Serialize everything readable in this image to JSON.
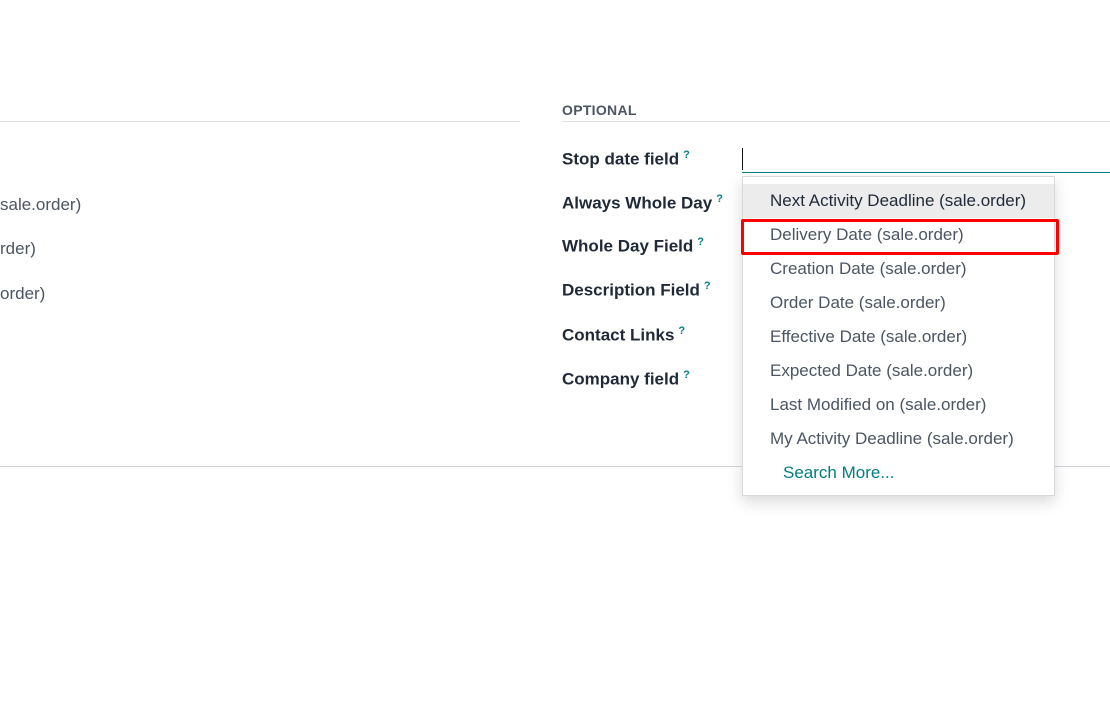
{
  "left_panel": {
    "values": [
      "sale.order)",
      "rder)",
      "order)"
    ]
  },
  "optional_section": {
    "title": "OPTIONAL",
    "help_marker": "?",
    "fields": [
      {
        "label": "Stop date field"
      },
      {
        "label": "Always Whole Day"
      },
      {
        "label": "Whole Day Field"
      },
      {
        "label": "Description Field"
      },
      {
        "label": "Contact Links"
      },
      {
        "label": "Company field"
      }
    ],
    "stop_date_input": {
      "value": ""
    }
  },
  "dropdown": {
    "items": [
      {
        "label": "Next Activity Deadline (sale.order)",
        "hovered": true
      },
      {
        "label": "Delivery Date (sale.order)",
        "highlighted": true
      },
      {
        "label": "Creation Date (sale.order)"
      },
      {
        "label": "Order Date (sale.order)"
      },
      {
        "label": "Effective Date (sale.order)"
      },
      {
        "label": "Expected Date (sale.order)"
      },
      {
        "label": "Last Modified on (sale.order)"
      },
      {
        "label": "My Activity Deadline (sale.order)"
      }
    ],
    "search_more": "Search More..."
  },
  "colors": {
    "accent": "#017e84",
    "highlight_outline": "#ff0000",
    "hover_bg": "#ececec"
  }
}
